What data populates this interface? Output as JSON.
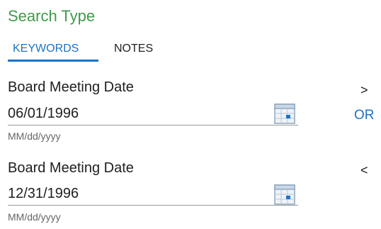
{
  "section_title": "Search Type",
  "tabs": [
    {
      "label": "KEYWORDS",
      "active": true
    },
    {
      "label": "NOTES",
      "active": false
    }
  ],
  "fields": [
    {
      "label": "Board Meeting Date",
      "value": "06/01/1996",
      "hint": "MM/dd/yyyy",
      "operator": ">"
    },
    {
      "label": "Board Meeting Date",
      "value": "12/31/1996",
      "hint": "MM/dd/yyyy",
      "operator": "<"
    }
  ],
  "conjunction": "OR",
  "colors": {
    "accent": "#1a73c8",
    "title": "#3f9a4a"
  }
}
